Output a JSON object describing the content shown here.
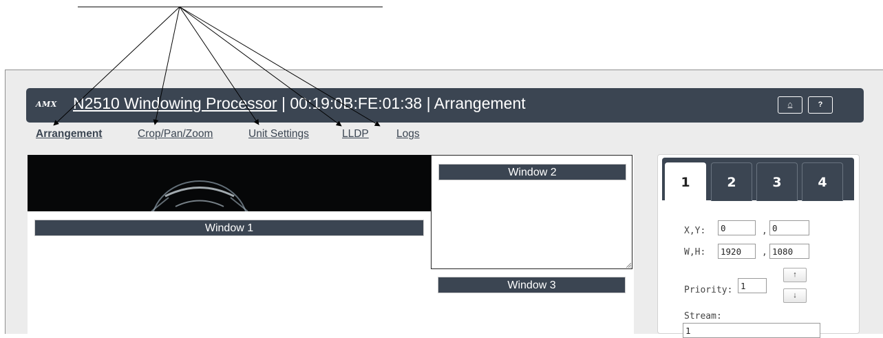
{
  "header": {
    "logo": "AMX",
    "device_name": "N2510 Windowing Processor",
    "separator": "|",
    "mac_address": "00:19:0B:FE:01:38",
    "page_name": "Arrangement",
    "user_button_label": "⌂",
    "help_button_label": "?"
  },
  "nav": {
    "items": [
      {
        "label": "Arrangement",
        "active": true
      },
      {
        "label": "Crop/Pan/Zoom",
        "active": false
      },
      {
        "label": "Unit Settings",
        "active": false
      },
      {
        "label": "LLDP",
        "active": false
      },
      {
        "label": "Logs",
        "active": false
      }
    ]
  },
  "windows": [
    {
      "label": "Window 1"
    },
    {
      "label": "Window 2"
    },
    {
      "label": "Window 3"
    }
  ],
  "panel": {
    "tabs": [
      "1",
      "2",
      "3",
      "4"
    ],
    "active_tab": "1",
    "xy_label": "X,Y:",
    "wh_label": "W,H:",
    "comma": ",",
    "x": "0",
    "y": "0",
    "w": "1920",
    "h": "1080",
    "priority_label": "Priority:",
    "priority": "1",
    "up_button": "↑",
    "down_button": "↓",
    "stream_label": "Stream:",
    "stream": "1"
  },
  "colors": {
    "header_bg": "#3b4552",
    "page_bg": "#ececec",
    "link": "#3b4552"
  }
}
